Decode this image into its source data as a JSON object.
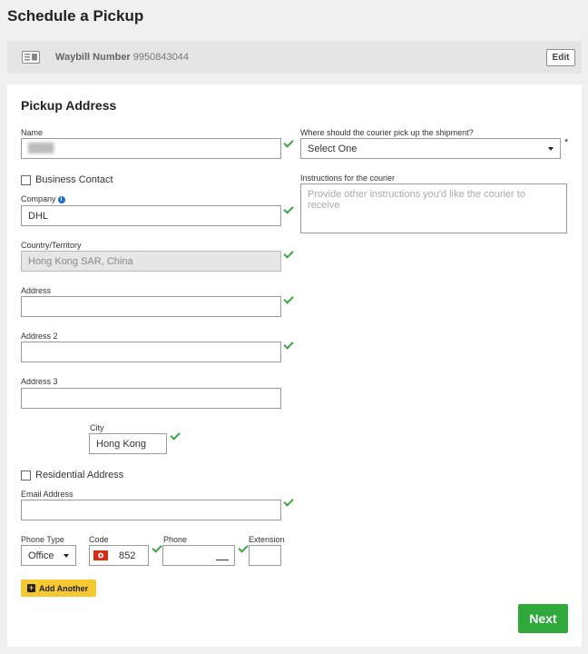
{
  "page": {
    "title": "Schedule a Pickup"
  },
  "waybill": {
    "label": "Waybill Number",
    "number": "9950843044",
    "edit_label": "Edit"
  },
  "pickup": {
    "section_title": "Pickup Address",
    "name": {
      "label": "Name"
    },
    "business_contact": {
      "label": "Business Contact"
    },
    "company": {
      "label": "Company",
      "value": "DHL"
    },
    "country": {
      "label": "Country/Territory",
      "value": "Hong Kong SAR, China"
    },
    "address1": {
      "label": "Address"
    },
    "address2": {
      "label": "Address 2"
    },
    "address3": {
      "label": "Address 3"
    },
    "city": {
      "label": "City",
      "value": "Hong Kong"
    },
    "residential": {
      "label": "Residential Address"
    },
    "email": {
      "label": "Email Address"
    },
    "phone_type": {
      "label": "Phone Type",
      "value": "Office"
    },
    "code": {
      "label": "Code",
      "value": "852"
    },
    "phone": {
      "label": "Phone"
    },
    "extension": {
      "label": "Extension"
    },
    "courier_location": {
      "label": "Where should the courier pick up the shipment?",
      "value": "Select One",
      "required": "*"
    },
    "instructions": {
      "label": "Instructions for the courier",
      "placeholder": "Provide other instructions you'd like the courier to receive"
    },
    "add_another": "Add Another",
    "next": "Next"
  }
}
